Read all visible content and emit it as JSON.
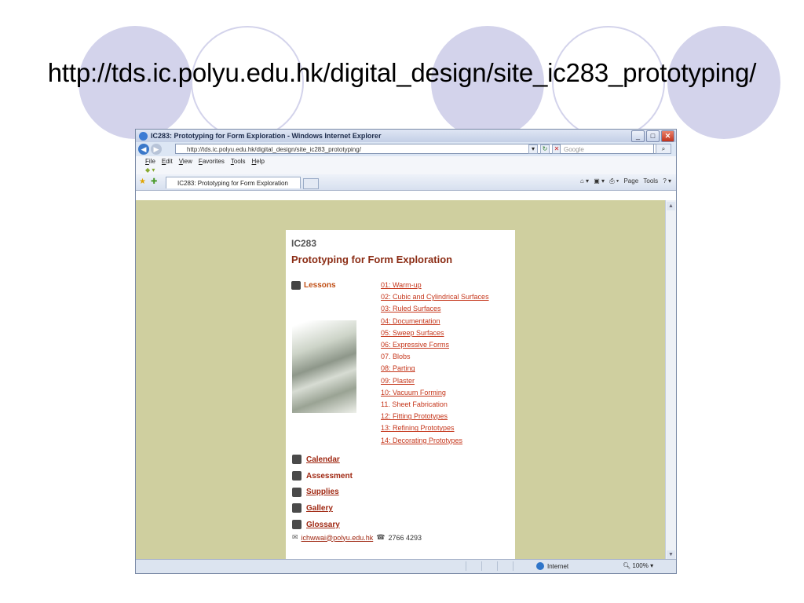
{
  "slide": {
    "title": "http://tds.ic.polyu.edu.hk/digital_design/site_ic283_prototyping/"
  },
  "browser": {
    "window_title": "IC283: Prototyping for Form Exploration - Windows Internet Explorer",
    "address": "http://tds.ic.polyu.edu.hk/digital_design/site_ic283_prototyping/",
    "search_placeholder": "Google",
    "menu": [
      "File",
      "Edit",
      "View",
      "Favorites",
      "Tools",
      "Help"
    ],
    "tab_label": "IC283: Prototyping for Form Exploration",
    "command_bar": {
      "page": "Page",
      "tools": "Tools"
    },
    "status": {
      "zone": "Internet",
      "zoom": "100%"
    }
  },
  "page": {
    "course_code": "IC283",
    "course_title": "Prototyping for Form Exploration",
    "lessons_label": "Lessons",
    "lessons": [
      {
        "label": "01: Warm-up",
        "link": true
      },
      {
        "label": "02: Cubic and Cylindrical Surfaces",
        "link": true
      },
      {
        "label": "03: Ruled Surfaces",
        "link": true
      },
      {
        "label": "04: Documentation",
        "link": true
      },
      {
        "label": "05: Sweep Surfaces",
        "link": true
      },
      {
        "label": "06: Expressive Forms",
        "link": true
      },
      {
        "label": "07. Blobs",
        "link": false
      },
      {
        "label": "08: Parting",
        "link": true
      },
      {
        "label": "09: Plaster",
        "link": true
      },
      {
        "label": "10: Vacuum Forming",
        "link": true
      },
      {
        "label": "11. Sheet Fabrication",
        "link": false
      },
      {
        "label": "12: Fitting Prototypes",
        "link": true
      },
      {
        "label": "13: Refining Prototypes",
        "link": true
      },
      {
        "label": "14: Decorating Prototypes",
        "link": true
      }
    ],
    "links": [
      {
        "label": "Calendar",
        "icon": "calendar-icon",
        "underline": true
      },
      {
        "label": "Assessment",
        "icon": "assessment-icon",
        "underline": false
      },
      {
        "label": "Supplies",
        "icon": "supplies-icon",
        "underline": true
      },
      {
        "label": "Gallery",
        "icon": "gallery-icon",
        "underline": true
      },
      {
        "label": "Glossary",
        "icon": "glossary-icon",
        "underline": true
      }
    ],
    "contact": {
      "email": "ichwwai@polyu.edu.hk",
      "phone": "2766 4293"
    }
  }
}
